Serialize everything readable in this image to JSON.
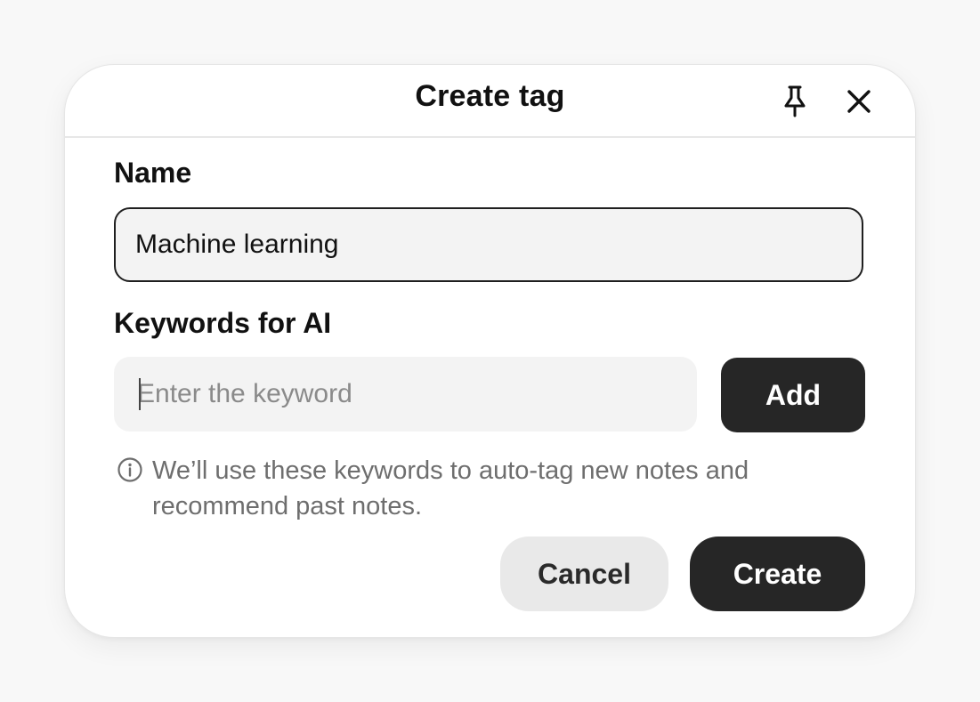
{
  "dialog": {
    "title": "Create tag",
    "header_icons": {
      "pin": "pin-icon",
      "close": "close-icon"
    }
  },
  "form": {
    "name": {
      "label": "Name",
      "value": "Machine learning"
    },
    "keywords": {
      "label": "Keywords for AI",
      "placeholder": "Enter the keyword",
      "value": "",
      "add_label": "Add"
    },
    "info": {
      "icon": "info-icon",
      "text": "We’ll use these keywords to auto-tag new notes and recommend past notes."
    }
  },
  "actions": {
    "cancel_label": "Cancel",
    "create_label": "Create"
  },
  "colors": {
    "primary_button": "#262626",
    "secondary_button": "#e9e9e9",
    "input_background": "#f3f3f3",
    "muted_text": "#6e6e6e"
  }
}
